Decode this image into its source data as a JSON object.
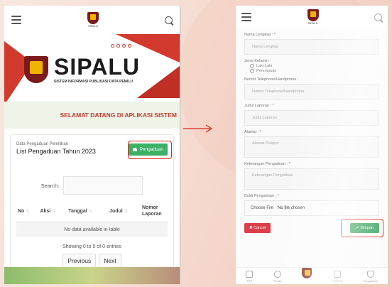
{
  "left": {
    "logo_small_text": "SIPALU",
    "brand_title": "SIPALU",
    "brand_subtitle": "SISTEM INFORMASI PUBLIKASI DATA PEMILU",
    "welcome": "SELAMAT DATANG DI APLIKASI SISTEM",
    "card_subtitle": "Data Pengaduan Pemilihan",
    "card_title": "List Pengaduan Tahun 2023",
    "button_label": "Pengaduan",
    "search_label": "Search:",
    "columns": [
      "No",
      "Aksi",
      "Tanggal",
      "Judul",
      "Nomor Laporan"
    ],
    "empty_text": "No data available in table",
    "showing": "Showing 0 to 0 of 0 entries",
    "prev": "Previous",
    "next": "Next"
  },
  "right": {
    "logo_small_text": "SIPALU",
    "fields": {
      "nama_label": "Nama Lengkap : *",
      "nama_placeholder": "Nama Lengkap",
      "jk_label": "Jenis Kelamin :",
      "jk_opt1": "Laki-Laki",
      "jk_opt2": "Perempuan",
      "telp_label": "Nomor Telephone/Handphone :",
      "telp_placeholder": "Nomor Telephone/Handphone",
      "judul_label": "Judul Laporan : *",
      "judul_placeholder": "Judul Laporan",
      "alamat_label": "Alamat : *",
      "alamat_placeholder": "Alamat Pelapor",
      "ket_label": "Keterangan Pengaduan : *",
      "ket_placeholder": "Keterangan Pengaduan",
      "bukti_label": "Bukti Pengaduan : *",
      "choose_file": "Choose File",
      "no_file": "No file chosen"
    },
    "cancel": "Cancel",
    "save": "Simpan",
    "nav": [
      "TPS",
      "Pemilu",
      "",
      "PARPOL",
      "Pengaduan"
    ]
  }
}
